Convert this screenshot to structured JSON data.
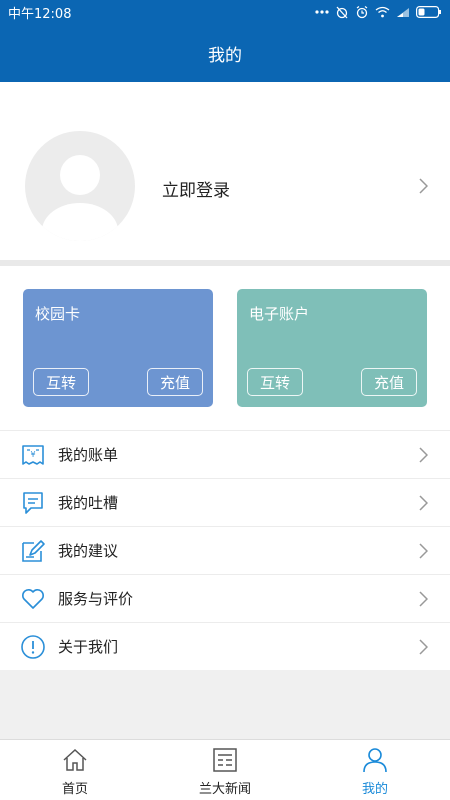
{
  "status_bar": {
    "time": "中午12:08"
  },
  "header": {
    "title": "我的"
  },
  "profile": {
    "login_label": "立即登录"
  },
  "cards": [
    {
      "title": "校园卡",
      "transfer_label": "互转",
      "recharge_label": "充值",
      "color": "#6d95d1"
    },
    {
      "title": "电子账户",
      "transfer_label": "互转",
      "recharge_label": "充值",
      "color": "#7fbfb8"
    }
  ],
  "menu": {
    "items": [
      {
        "label": "我的账单",
        "icon": "bill-icon"
      },
      {
        "label": "我的吐槽",
        "icon": "chat-icon"
      },
      {
        "label": "我的建议",
        "icon": "edit-icon"
      },
      {
        "label": "服务与评价",
        "icon": "heart-icon"
      },
      {
        "label": "关于我们",
        "icon": "info-icon"
      }
    ]
  },
  "tabbar": {
    "tabs": [
      {
        "label": "首页",
        "icon": "home-icon",
        "active": false
      },
      {
        "label": "兰大新闻",
        "icon": "news-icon",
        "active": false
      },
      {
        "label": "我的",
        "icon": "user-icon",
        "active": true
      }
    ]
  },
  "colors": {
    "primary": "#0b66b3",
    "icon_blue": "#2b8fd8",
    "active_tab": "#1a8ad9"
  }
}
